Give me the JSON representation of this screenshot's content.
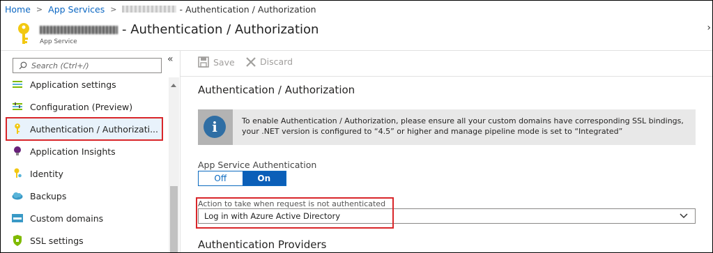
{
  "breadcrumb": {
    "home": "Home",
    "app_services": "App Services",
    "current": "- Authentication / Authorization"
  },
  "header": {
    "title": "- Authentication / Authorization",
    "subtitle": "App Service",
    "close": "›"
  },
  "sidebar": {
    "collapse": "«",
    "search_placeholder": "Search (Ctrl+/)",
    "items": [
      {
        "label": "Application settings",
        "icon": "app-settings-icon"
      },
      {
        "label": "Configuration (Preview)",
        "icon": "configuration-icon"
      },
      {
        "label": "Authentication / Authorizati...",
        "icon": "key-icon",
        "active": true
      },
      {
        "label": "Application Insights",
        "icon": "lightbulb-icon"
      },
      {
        "label": "Identity",
        "icon": "identity-icon"
      },
      {
        "label": "Backups",
        "icon": "backups-icon"
      },
      {
        "label": "Custom domains",
        "icon": "custom-domains-icon"
      },
      {
        "label": "SSL settings",
        "icon": "ssl-shield-icon"
      }
    ]
  },
  "toolbar": {
    "save_label": "Save",
    "discard_label": "Discard"
  },
  "main": {
    "section_title": "Authentication / Authorization",
    "info_message": "To enable Authentication / Authorization, please ensure all your custom domains have corresponding SSL bindings, your .NET version is configured to “4.5” or higher and manage pipeline mode is set to “Integrated”",
    "app_service_auth_label": "App Service Authentication",
    "toggle_off": "Off",
    "toggle_on": "On",
    "action_label": "Action to take when request is not authenticated",
    "action_value": "Log in with Azure Active Directory",
    "providers_title": "Authentication Providers"
  },
  "colors": {
    "accent": "#0b5fb8",
    "link": "#0a66c2",
    "highlight_box": "#d9262a"
  }
}
